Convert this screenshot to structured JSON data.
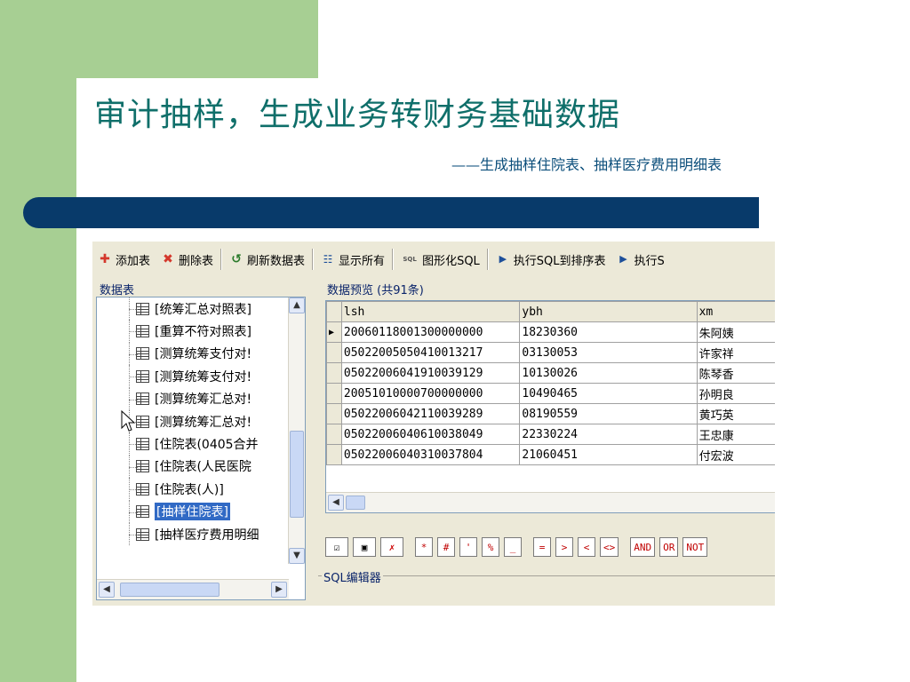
{
  "slide": {
    "title": "审计抽样，生成业务转财务基础数据",
    "subtitle": "——生成抽样住院表、抽样医疗费用明细表"
  },
  "toolbar": {
    "add_table": "添加表",
    "delete_table": "删除表",
    "refresh_table": "刷新数据表",
    "show_all": "显示所有",
    "graphical_sql_icon": "SQL",
    "graphical_sql": "图形化SQL",
    "exec_sql_sort": "执行SQL到排序表",
    "exec_sql_more": "执行S"
  },
  "tree": {
    "group_label": "数据表",
    "items": [
      {
        "label": "[统筹汇总对照表]"
      },
      {
        "label": "[重算不符对照表]"
      },
      {
        "label": "[测算统筹支付对!"
      },
      {
        "label": "[测算统筹支付对!"
      },
      {
        "label": "[测算统筹汇总对!"
      },
      {
        "label": "[测算统筹汇总对!"
      },
      {
        "label": "[住院表(0405合并"
      },
      {
        "label": "[住院表(人民医院"
      },
      {
        "label": "[住院表(人)]"
      },
      {
        "label": "[抽样住院表]"
      },
      {
        "label": "[抽样医疗费用明细"
      }
    ],
    "selected_index": 9
  },
  "preview": {
    "group_label": "数据预览 (共91条)",
    "columns": [
      "lsh",
      "ybh",
      "xm"
    ],
    "rows": [
      [
        "20060118001300000000",
        "18230360",
        "朱阿姨"
      ],
      [
        "05022005050410013217",
        "03130053",
        "许家祥"
      ],
      [
        "05022006041910039129",
        "10130026",
        "陈琴香"
      ],
      [
        "20051010000700000000",
        "10490465",
        "孙明良"
      ],
      [
        "05022006042110039289",
        "08190559",
        "黄巧英"
      ],
      [
        "05022006040610038049",
        "22330224",
        "王忠康"
      ],
      [
        "05022006040310037804",
        "21060451",
        "付宏波"
      ]
    ],
    "current_row_index": 0
  },
  "operators": [
    "*",
    "#",
    "'",
    "%",
    "_",
    "=",
    ">",
    "<",
    "<>",
    "AND",
    "OR",
    "NOT"
  ],
  "sql_editor": {
    "group_label": "SQL编辑器"
  },
  "colors": {
    "slide_green": "#a7cf93",
    "title_teal": "#0f6f6a",
    "band_navy": "#083a6a",
    "selection_blue": "#316ac5"
  }
}
